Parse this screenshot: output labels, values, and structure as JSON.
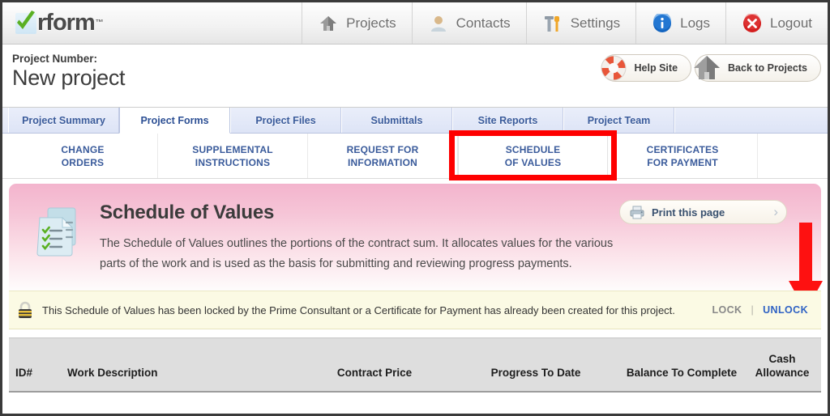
{
  "brand": {
    "name": "rform",
    "trademark": "™"
  },
  "topnav": {
    "items": [
      {
        "label": "Projects",
        "icon": "house-icon"
      },
      {
        "label": "Contacts",
        "icon": "person-icon"
      },
      {
        "label": "Settings",
        "icon": "tools-icon"
      },
      {
        "label": "Logs",
        "icon": "info-icon"
      },
      {
        "label": "Logout",
        "icon": "close-circle-icon"
      }
    ]
  },
  "project": {
    "number_label": "Project Number:",
    "title": "New project",
    "help_button": "Help Site",
    "back_button": "Back to Projects"
  },
  "tabs": [
    {
      "label": "Project Summary",
      "active": false
    },
    {
      "label": "Project Forms",
      "active": true
    },
    {
      "label": "Project Files",
      "active": false
    },
    {
      "label": "Submittals",
      "active": false
    },
    {
      "label": "Site Reports",
      "active": false
    },
    {
      "label": "Project Team",
      "active": false
    }
  ],
  "subnav": [
    {
      "line1": "CHANGE",
      "line2": "ORDERS",
      "current": false
    },
    {
      "line1": "SUPPLEMENTAL",
      "line2": "INSTRUCTIONS",
      "current": false
    },
    {
      "line1": "REQUEST FOR",
      "line2": "INFORMATION",
      "current": false
    },
    {
      "line1": "SCHEDULE",
      "line2": "OF VALUES",
      "current": true
    },
    {
      "line1": "CERTIFICATES",
      "line2": "FOR PAYMENT",
      "current": false
    }
  ],
  "banner": {
    "heading": "Schedule of Values",
    "description": "The Schedule of Values outlines the portions of the contract sum. It allocates values for the various parts of the work and is used as the basis for submitting and reviewing progress payments.",
    "print_label": "Print this page",
    "print_chevron": "›"
  },
  "lockbar": {
    "message": "This Schedule of Values has been locked by the Prime Consultant or a Certificate for Payment has already been created for this project.",
    "lock_label": "LOCK",
    "separator": "|",
    "unlock_label": "UNLOCK"
  },
  "table": {
    "columns": [
      {
        "line1": "",
        "line2": "ID#"
      },
      {
        "line1": "",
        "line2": "Work Description"
      },
      {
        "line1": "",
        "line2": "Contract Price"
      },
      {
        "line1": "",
        "line2": "Progress To Date"
      },
      {
        "line1": "",
        "line2": "Balance To Complete"
      },
      {
        "line1": "Cash",
        "line2": "Allowance"
      }
    ]
  },
  "annotations": {
    "highlight_target": "SCHEDULE OF VALUES",
    "arrow_target": "UNLOCK",
    "highlight_color": "#fe0000"
  }
}
